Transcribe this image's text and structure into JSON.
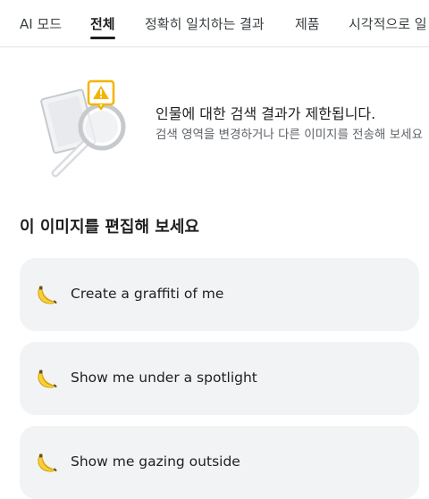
{
  "tabs": [
    {
      "label": "AI 모드",
      "active": false
    },
    {
      "label": "전체",
      "active": true
    },
    {
      "label": "정확히 일치하는 결과",
      "active": false
    },
    {
      "label": "제품",
      "active": false
    },
    {
      "label": "시각적으로 일",
      "active": false
    }
  ],
  "notice": {
    "icon": "magnifier-warning-illustration",
    "title": "인물에 대한 검색 결과가 제한됩니다.",
    "description": "검색 영역을 변경하거나 다른 이미지를 전송해 보세요"
  },
  "edit_section": {
    "heading": "이 이미지를 편집해 보세요",
    "suggestions": [
      {
        "icon": "banana-icon",
        "label": "Create a graffiti of me"
      },
      {
        "icon": "banana-icon",
        "label": "Show me under a spotlight"
      },
      {
        "icon": "banana-icon",
        "label": "Show me gazing outside"
      }
    ]
  },
  "colors": {
    "card_background": "#f1f3f4",
    "warning_yellow": "#f4b400",
    "text_primary": "#1f1f1f",
    "text_secondary": "#5f6368"
  }
}
